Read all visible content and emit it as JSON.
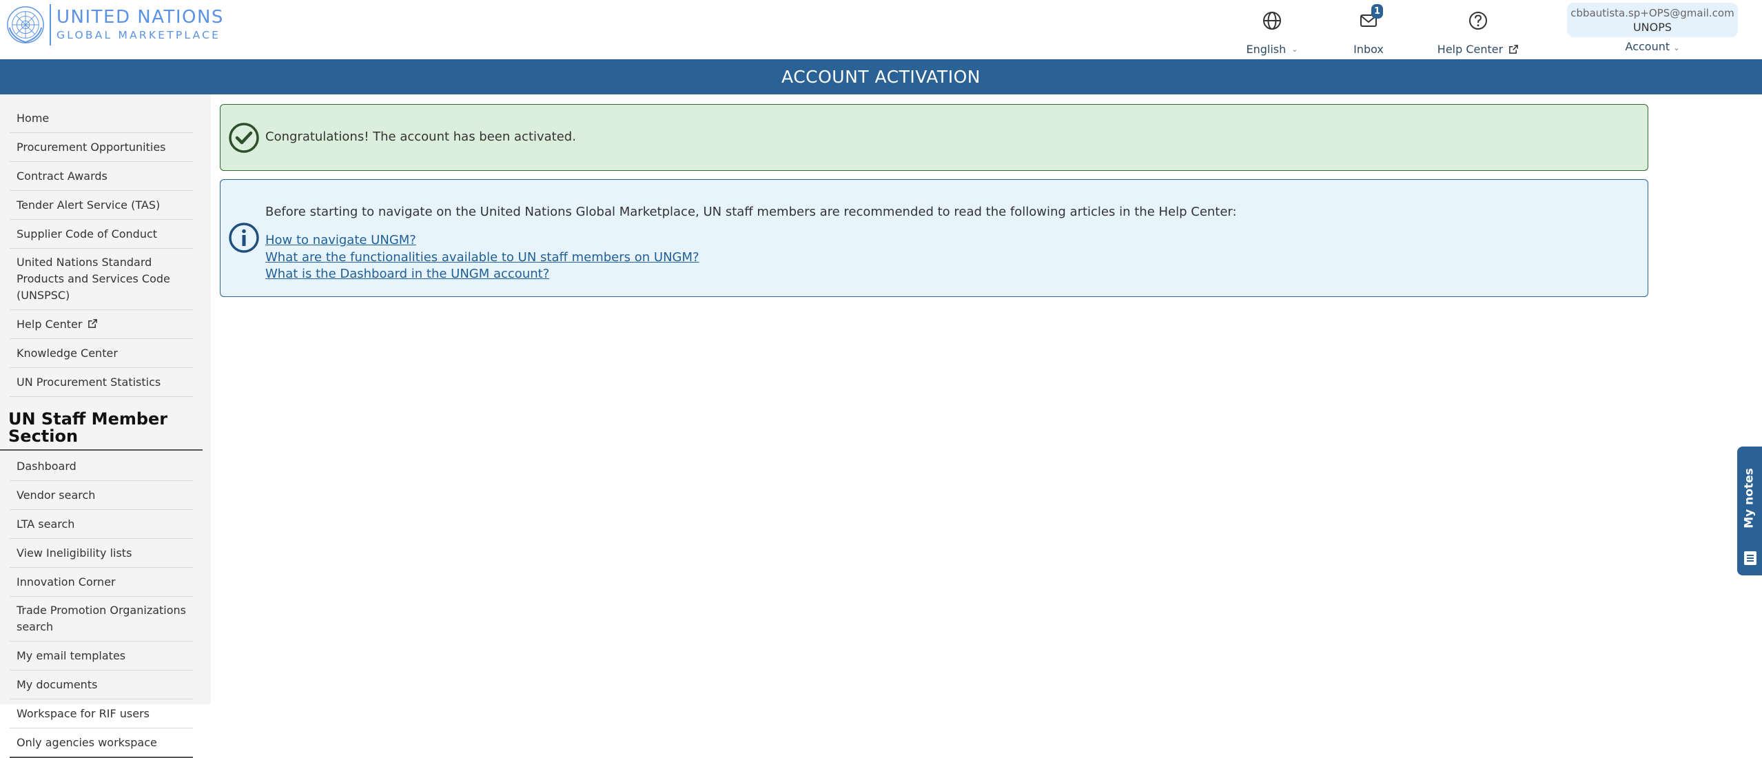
{
  "brand": {
    "line1": "UNITED NATIONS",
    "line2": "GLOBAL MARKETPLACE"
  },
  "header": {
    "language": {
      "label": "English",
      "icon": "globe-icon"
    },
    "inbox": {
      "label": "Inbox",
      "count": "1",
      "icon": "mail-icon"
    },
    "help": {
      "label": "Help Center",
      "icon": "question-circle-icon"
    },
    "account": {
      "email": "cbbautista.sp+OPS@gmail.com",
      "org": "UNOPS",
      "label": "Account"
    }
  },
  "page_title": "ACCOUNT ACTIVATION",
  "sidebar": {
    "items": [
      "Home",
      "Procurement Opportunities",
      "Contract Awards",
      "Tender Alert Service (TAS)",
      "Supplier Code of Conduct",
      "United Nations Standard Products and Services Code (UNSPSC)",
      "Help Center",
      "Knowledge Center",
      "UN Procurement Statistics"
    ],
    "staff_section_title": "UN Staff Member Section",
    "staff_items": [
      "Dashboard",
      "Vendor search",
      "LTA search",
      "View Ineligibility lists",
      "Innovation Corner",
      "Trade Promotion Organizations search",
      "My email templates",
      "My documents",
      "Workspace for RIF users",
      "Only agencies workspace"
    ]
  },
  "success_alert": {
    "text": "Congratulations! The account has been activated."
  },
  "info_alert": {
    "intro": "Before starting to navigate on the United Nations Global Marketplace, UN staff members are recommended to read the following articles in the Help Center:",
    "links": [
      "How to navigate UNGM?",
      "What are the functionalities available to UN staff members on UNGM?",
      "What is the Dashboard in the UNGM account?"
    ]
  },
  "notes_tab": {
    "label": "My notes"
  },
  "colors": {
    "primary": "#2a6296",
    "success_bg": "#dcefdc",
    "info_bg": "#e8f4fc",
    "brand_blue": "#5b92e5"
  }
}
